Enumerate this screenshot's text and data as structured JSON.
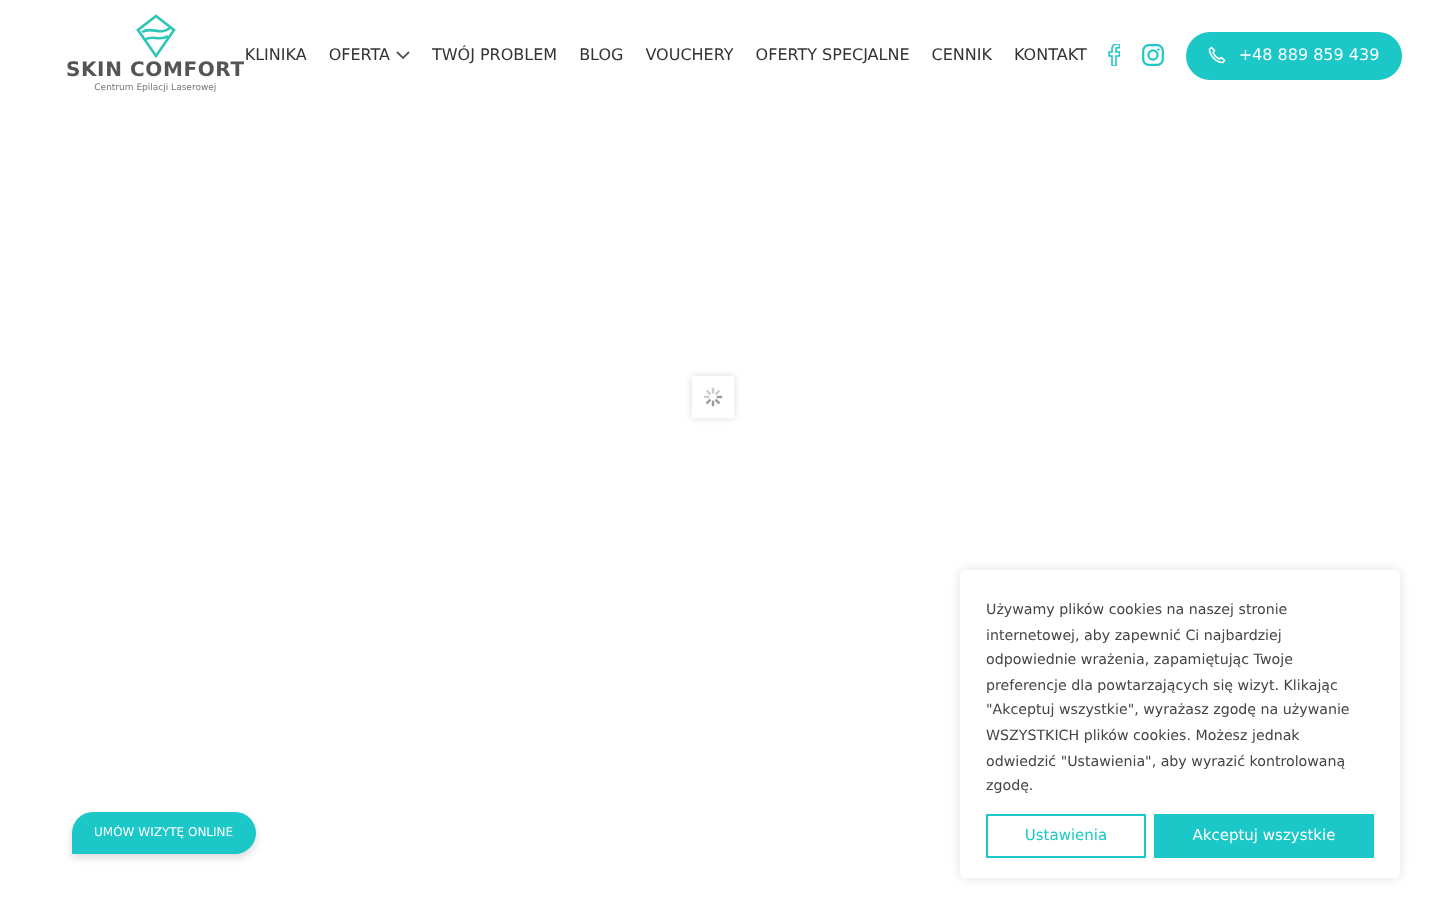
{
  "logo": {
    "name": "SKIN COMFORT",
    "tagline": "Centrum Epilacji Laserowej"
  },
  "nav": [
    {
      "label": "KLINIKA",
      "dropdown": false
    },
    {
      "label": "OFERTA",
      "dropdown": true
    },
    {
      "label": "TWÓJ PROBLEM",
      "dropdown": false
    },
    {
      "label": "BLOG",
      "dropdown": false
    },
    {
      "label": "VOUCHERY",
      "dropdown": false
    },
    {
      "label": "OFERTY SPECJALNE",
      "dropdown": false
    },
    {
      "label": "CENNIK",
      "dropdown": false
    },
    {
      "label": "KONTAKT",
      "dropdown": false
    }
  ],
  "phone_button": "+48 889 859 439",
  "booking_button": "UMÓW WIZYTĘ ONLINE",
  "cookie_notice": {
    "text": "Używamy plików cookies na naszej stronie internetowej, aby zapewnić Ci najbardziej odpowiednie wrażenia, zapamiętując Twoje preferencje dla powtarzających się wizyt. Klikając \"Akceptuj wszystkie\", wyrażasz zgodę na używanie WSZYSTKICH plików cookies. Możesz jednak odwiedzić \"Ustawienia\", aby wyrazić kontrolowaną zgodę.",
    "buttons": [
      {
        "label": "Ustawienia",
        "kind": "outline"
      },
      {
        "label": "Akceptuj wszystkie",
        "kind": "solid"
      }
    ]
  }
}
